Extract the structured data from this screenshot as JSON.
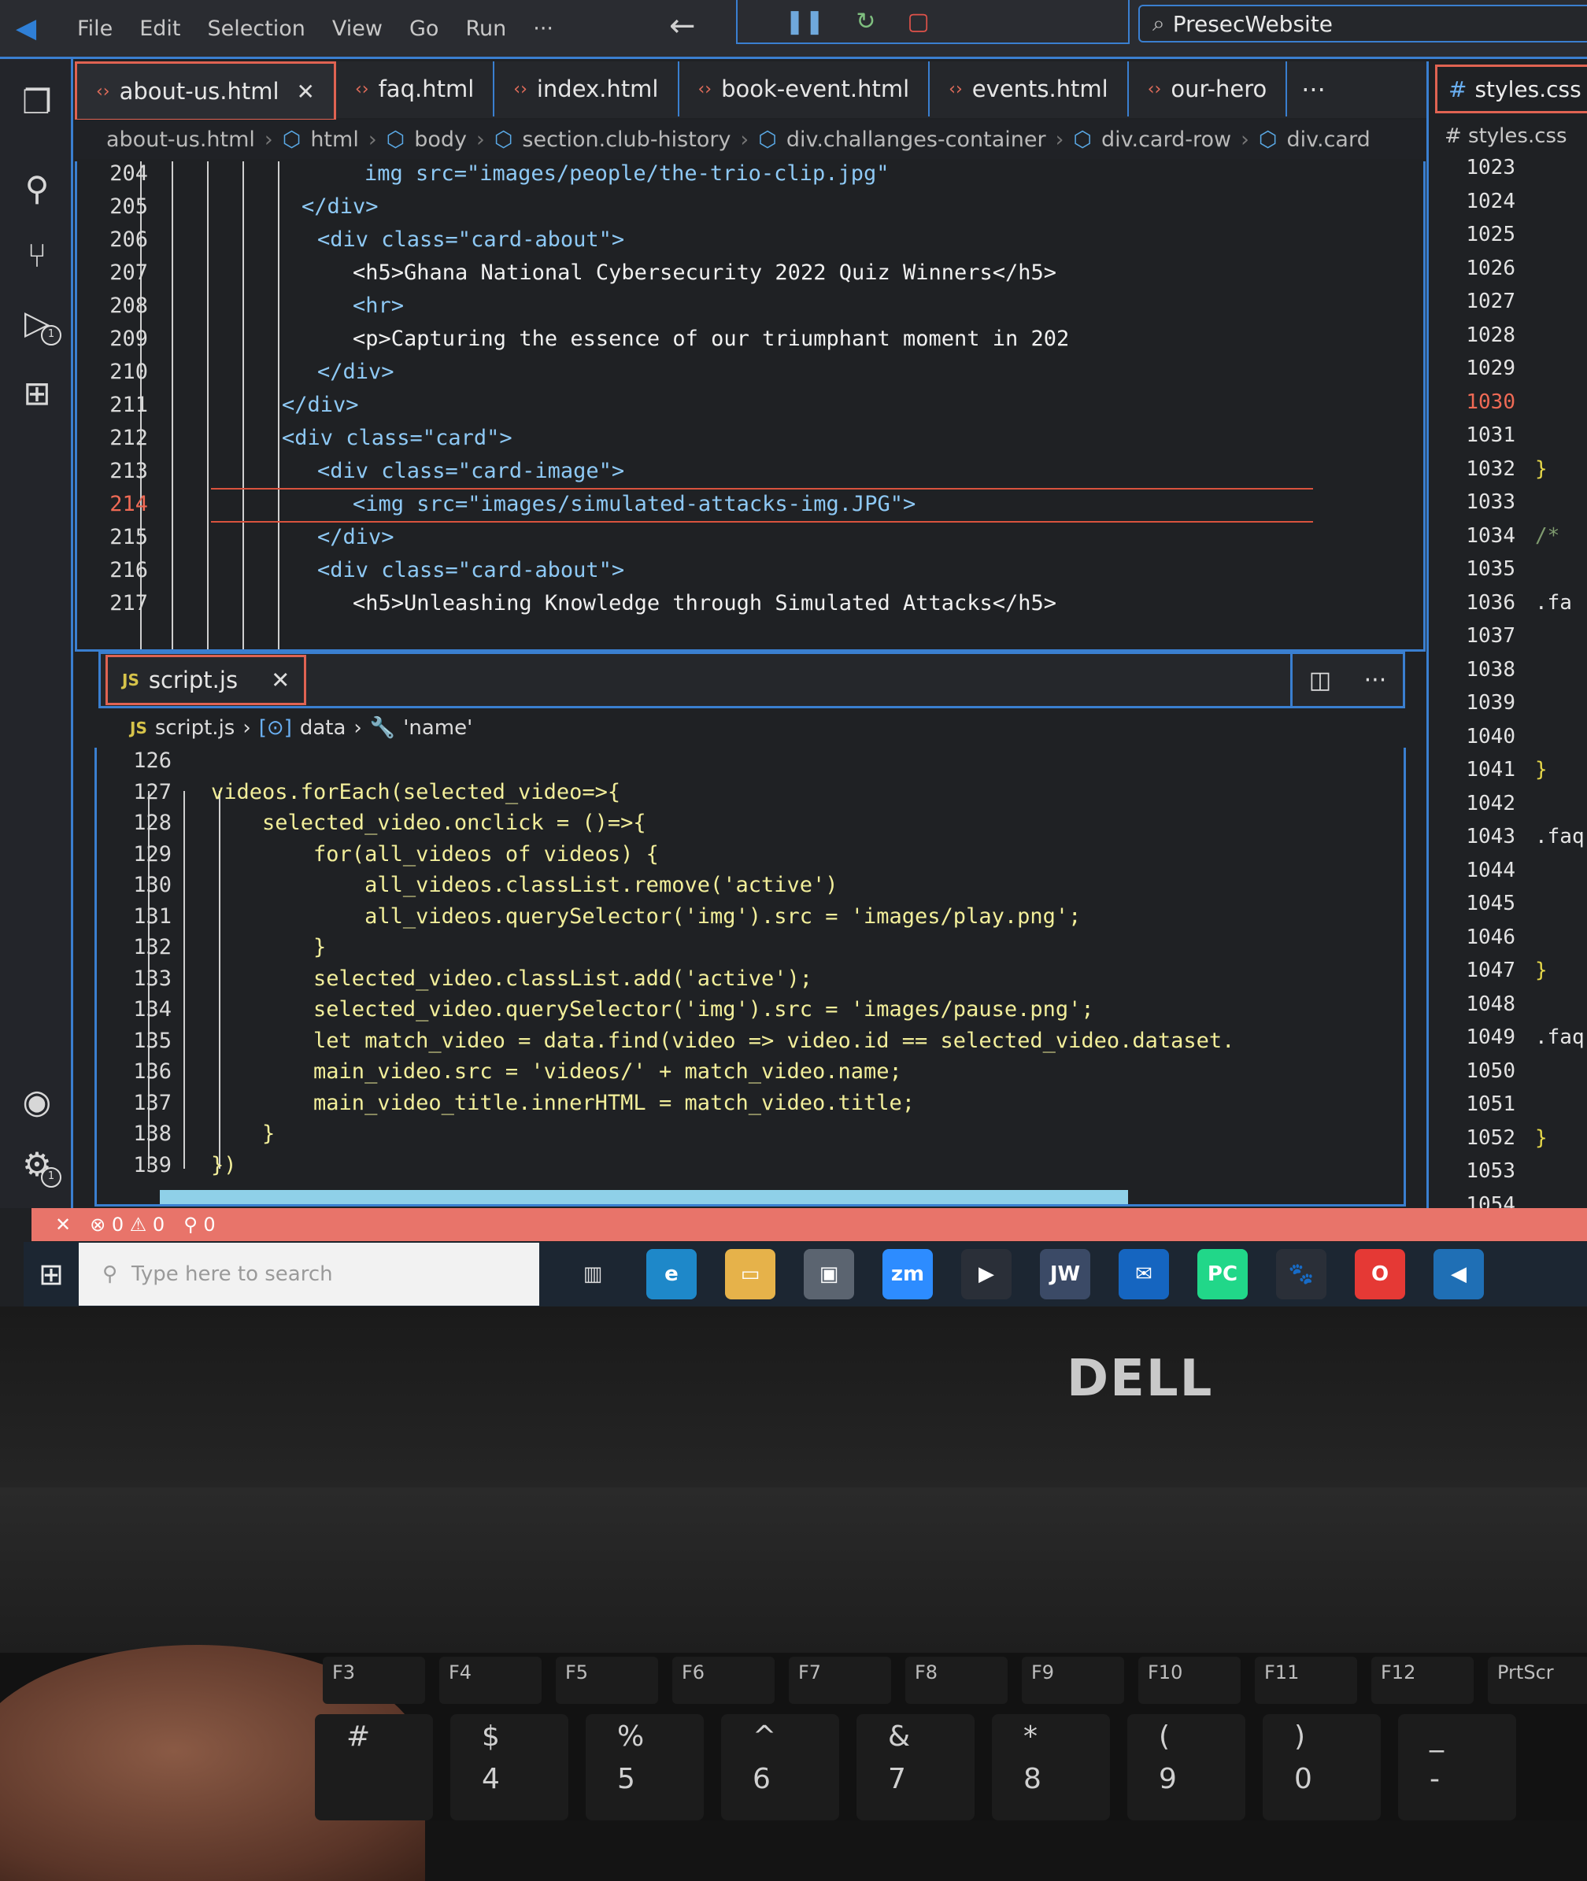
{
  "menu": [
    "File",
    "Edit",
    "Selection",
    "View",
    "Go",
    "Run",
    "···"
  ],
  "search_box": "PresecWebsite",
  "top_tabs": [
    {
      "label": "about-us.html",
      "active": true
    },
    {
      "label": "faq.html"
    },
    {
      "label": "index.html"
    },
    {
      "label": "book-event.html"
    },
    {
      "label": "events.html"
    },
    {
      "label": "our-hero"
    }
  ],
  "tabs_more": "···",
  "breadcrumb": [
    "about-us.html",
    "html",
    "body",
    "section.club-history",
    "div.challanges-container",
    "div.card-row",
    "div.card"
  ],
  "html_lines": [
    {
      "n": "204",
      "code": "img src=\"images/people/the-trio-clip.jpg\""
    },
    {
      "n": "205",
      "code": "</div>"
    },
    {
      "n": "206",
      "code": "<div class=\"card-about\">"
    },
    {
      "n": "207",
      "code": "<h5>Ghana National Cybersecurity 2022 Quiz Winners</h5>"
    },
    {
      "n": "208",
      "code": "<hr>"
    },
    {
      "n": "209",
      "code": "<p>Capturing the essence of our triumphant moment in 202"
    },
    {
      "n": "210",
      "code": "</div>"
    },
    {
      "n": "211",
      "code": "</div>"
    },
    {
      "n": "212",
      "code": "<div class=\"card\">"
    },
    {
      "n": "213",
      "code": "<div class=\"card-image\">"
    },
    {
      "n": "214",
      "code": "<img src=\"images/simulated-attacks-img.JPG\">"
    },
    {
      "n": "215",
      "code": "</div>"
    },
    {
      "n": "216",
      "code": "<div class=\"card-about\">"
    },
    {
      "n": "217",
      "code": "<h5>Unleashing Knowledge through Simulated Attacks</h5>"
    }
  ],
  "js_tab": {
    "badge": "JS",
    "label": "script.js"
  },
  "js_breadcrumb": [
    "script.js",
    "data",
    "'name'"
  ],
  "js_lines": [
    {
      "n": "126",
      "code": ""
    },
    {
      "n": "127",
      "code": "videos.forEach(selected_video=>{"
    },
    {
      "n": "128",
      "code": "    selected_video.onclick = ()=>{"
    },
    {
      "n": "129",
      "code": "        for(all_videos of videos) {"
    },
    {
      "n": "130",
      "code": "            all_videos.classList.remove('active')"
    },
    {
      "n": "131",
      "code": "            all_videos.querySelector('img').src = 'images/play.png';"
    },
    {
      "n": "132",
      "code": "        }"
    },
    {
      "n": "133",
      "code": "        selected_video.classList.add('active');"
    },
    {
      "n": "134",
      "code": "        selected_video.querySelector('img').src = 'images/pause.png';"
    },
    {
      "n": "135",
      "code": "        let match_video = data.find(video => video.id == selected_video.dataset."
    },
    {
      "n": "136",
      "code": "        main_video.src = 'videos/' + match_video.name;"
    },
    {
      "n": "137",
      "code": "        main_video_title.innerHTML = match_video.title;"
    },
    {
      "n": "138",
      "code": "    }"
    },
    {
      "n": "139",
      "code": "})"
    }
  ],
  "css_tab": "styles.css",
  "css_breadcrumb": "# styles.css",
  "css_lines": [
    {
      "n": "1023",
      "c": ""
    },
    {
      "n": "1024",
      "c": ""
    },
    {
      "n": "1025",
      "c": ""
    },
    {
      "n": "1026",
      "c": ""
    },
    {
      "n": "1027",
      "c": ""
    },
    {
      "n": "1028",
      "c": ""
    },
    {
      "n": "1029",
      "c": ""
    },
    {
      "n": "1030",
      "c": ""
    },
    {
      "n": "1031",
      "c": ""
    },
    {
      "n": "1032",
      "c": "}"
    },
    {
      "n": "1033",
      "c": ""
    },
    {
      "n": "1034",
      "c": "/*"
    },
    {
      "n": "1035",
      "c": ""
    },
    {
      "n": "1036",
      "c": ".fa"
    },
    {
      "n": "1037",
      "c": ""
    },
    {
      "n": "1038",
      "c": ""
    },
    {
      "n": "1039",
      "c": ""
    },
    {
      "n": "1040",
      "c": ""
    },
    {
      "n": "1041",
      "c": "}"
    },
    {
      "n": "1042",
      "c": ""
    },
    {
      "n": "1043",
      "c": ".faq"
    },
    {
      "n": "1044",
      "c": ""
    },
    {
      "n": "1045",
      "c": ""
    },
    {
      "n": "1046",
      "c": ""
    },
    {
      "n": "1047",
      "c": "}"
    },
    {
      "n": "1048",
      "c": ""
    },
    {
      "n": "1049",
      "c": ".faq-"
    },
    {
      "n": "1050",
      "c": ""
    },
    {
      "n": "1051",
      "c": ""
    },
    {
      "n": "1052",
      "c": "}"
    },
    {
      "n": "1053",
      "c": ""
    },
    {
      "n": "1054",
      "c": ""
    }
  ],
  "status": {
    "errors": "0",
    "warnings": "0",
    "ports": "0"
  },
  "taskbar_search": "Type here to search",
  "taskbar_icons": [
    {
      "name": "edge-icon",
      "label": "e",
      "color": "#1e88c9"
    },
    {
      "name": "file-explorer-icon",
      "label": "▭",
      "color": "#e6b24a"
    },
    {
      "name": "store-icon",
      "label": "▣",
      "color": "#5b6470"
    },
    {
      "name": "zoom-icon",
      "label": "zm",
      "color": "#2d8cff"
    },
    {
      "name": "media-player-icon",
      "label": "▶",
      "color": "#2a2f38"
    },
    {
      "name": "jw-icon",
      "label": "JW",
      "color": "#3b4a66"
    },
    {
      "name": "mail-icon",
      "label": "✉",
      "color": "#1565c0"
    },
    {
      "name": "pycharm-icon",
      "label": "PC",
      "color": "#21d789"
    },
    {
      "name": "paw-icon",
      "label": "🐾",
      "color": "#2a2f38"
    },
    {
      "name": "opera-icon",
      "label": "O",
      "color": "#e53935"
    },
    {
      "name": "vscode-icon",
      "label": "◀",
      "color": "#1f6fb5"
    }
  ],
  "brand": "DELL",
  "fkeys": [
    "F3",
    "F4",
    "F5",
    "F6",
    "F7",
    "F8",
    "F9",
    "F10",
    "F11",
    "F12",
    "PrtScr"
  ],
  "numkeys": [
    {
      "top": "#",
      "bot": ""
    },
    {
      "top": "$",
      "bot": "4"
    },
    {
      "top": "%",
      "bot": "5"
    },
    {
      "top": "^",
      "bot": "6"
    },
    {
      "top": "&",
      "bot": "7"
    },
    {
      "top": "*",
      "bot": "8"
    },
    {
      "top": "(",
      "bot": "9"
    },
    {
      "top": ")",
      "bot": "0"
    },
    {
      "top": "_",
      "bot": "-"
    }
  ]
}
